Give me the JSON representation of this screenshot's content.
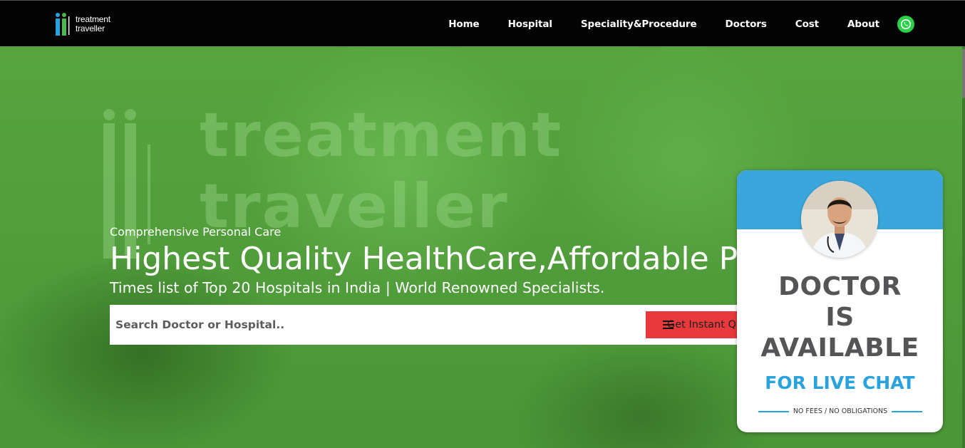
{
  "brand": {
    "logo_line1": "treatment",
    "logo_line2": "traveller",
    "watermark_line1": "treatment",
    "watermark_line2": "traveller"
  },
  "nav": {
    "items": [
      {
        "label": "Home"
      },
      {
        "label": "Hospital"
      },
      {
        "label": "Speciality&Procedure"
      },
      {
        "label": "Doctors"
      },
      {
        "label": "Cost"
      },
      {
        "label": "About"
      }
    ],
    "whatsapp_icon": "whatsapp-icon"
  },
  "hero": {
    "tagline": "Comprehensive Personal Care",
    "headline": "Highest Quality HealthCare,Affordable Prices",
    "subline": "Times list of Top 20 Hospitals in India | World Renowned Specialists.",
    "background_color": "#5aa941"
  },
  "search": {
    "placeholder": "Search Doctor or Hospital..",
    "button_label": "Get Instant Quote",
    "button_icon": "hamburger-icon",
    "button_color": "#e8393c"
  },
  "chat_widget": {
    "line1": "DOCTOR",
    "line2": "IS",
    "line3": "AVAILABLE",
    "cta": "FOR LIVE CHAT",
    "note": "NO FEES / NO OBLIGATIONS",
    "accent_color": "#3aa6dc"
  }
}
